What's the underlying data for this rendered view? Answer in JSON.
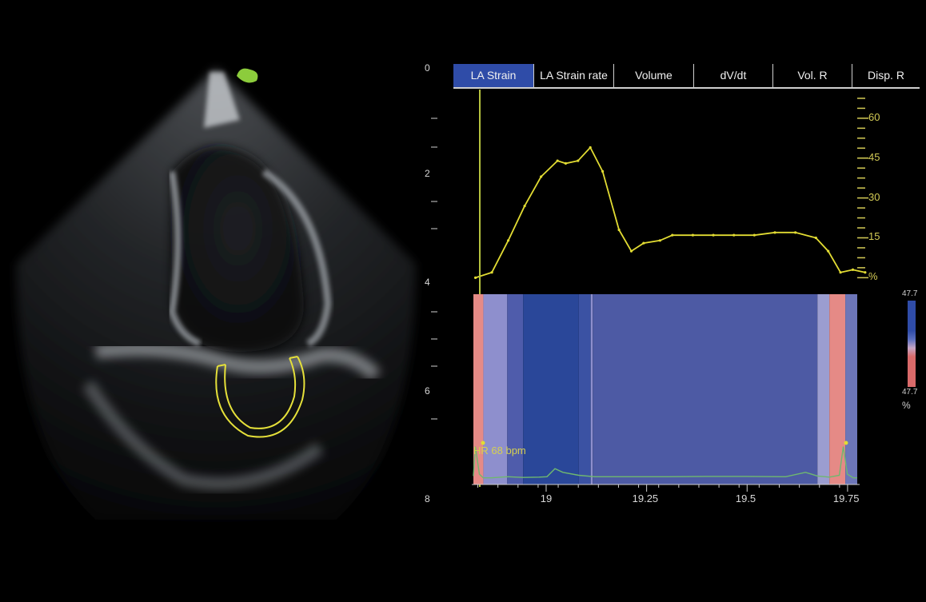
{
  "tabs": [
    {
      "label": "LA Strain",
      "active": true
    },
    {
      "label": "LA Strain rate",
      "active": false
    },
    {
      "label": "Volume",
      "active": false
    },
    {
      "label": "dV/dt",
      "active": false
    },
    {
      "label": "Vol. R",
      "active": false
    },
    {
      "label": "Disp. R",
      "active": false
    }
  ],
  "left_axis_labels": [
    "0",
    "2",
    "4",
    "6",
    "8"
  ],
  "strain_axis": {
    "ticks": [
      "60",
      "45",
      "30",
      "15",
      "%"
    ]
  },
  "colorbar": {
    "top": "47.7",
    "bottom": "47.7",
    "unit": "%",
    "colors": [
      "#2f4ca8",
      "#5b6fc0",
      "#c7a5c4",
      "#d96a6a"
    ]
  },
  "heart_rate_label": "HR 68 bpm",
  "time_axis": {
    "ticks": [
      "19",
      "19.25",
      "19.5",
      "19.75"
    ]
  },
  "colors": {
    "strain_curve": "#e2dc33",
    "ecg": "#6fb86f",
    "cursor": "#b5c23e",
    "tracking_roi": "#e5e03a",
    "marker": "#8ccc3c"
  },
  "chart_data": {
    "type": "line",
    "x": [
      18.82,
      18.86,
      18.9,
      18.94,
      18.98,
      19.02,
      19.04,
      19.07,
      19.1,
      19.13,
      19.17,
      19.2,
      19.23,
      19.27,
      19.3,
      19.35,
      19.4,
      19.45,
      19.5,
      19.55,
      19.6,
      19.65,
      19.68,
      19.71,
      19.74,
      19.77
    ],
    "y": [
      0,
      2,
      14,
      27,
      38,
      44,
      43,
      44,
      49,
      40,
      18,
      10,
      13,
      14,
      16,
      16,
      16,
      16,
      16,
      17,
      17,
      15,
      10,
      2,
      3,
      2
    ],
    "xlabel": "",
    "ylabel": "",
    "ylim": [
      -2,
      72
    ],
    "xlim": [
      18.815,
      19.78
    ],
    "y_ticks": [
      60,
      45,
      30,
      15
    ]
  },
  "segments": [
    {
      "x0": 18.815,
      "x1": 18.84,
      "color": "#e58a86"
    },
    {
      "x0": 18.84,
      "x1": 18.9,
      "color": "#8e8fcd"
    },
    {
      "x0": 18.9,
      "x1": 18.94,
      "color": "#4f5cab"
    },
    {
      "x0": 18.94,
      "x1": 19.08,
      "color": "#2a4799"
    },
    {
      "x0": 19.08,
      "x1": 19.11,
      "color": "#3b52a3"
    },
    {
      "x0": 19.11,
      "x1": 19.115,
      "color": "#8e8fcd"
    },
    {
      "x0": 19.115,
      "x1": 19.68,
      "color": "#4d5aa4"
    },
    {
      "x0": 19.68,
      "x1": 19.71,
      "color": "#9b9dd0"
    },
    {
      "x0": 19.71,
      "x1": 19.75,
      "color": "#e58a86"
    },
    {
      "x0": 19.75,
      "x1": 19.78,
      "color": "#6d76b8"
    }
  ],
  "ecg_trace": {
    "x": [
      18.815,
      18.82,
      18.83,
      18.84,
      18.86,
      18.9,
      18.94,
      18.98,
      19.0,
      19.02,
      19.04,
      19.08,
      19.12,
      19.2,
      19.3,
      19.4,
      19.5,
      19.6,
      19.65,
      19.68,
      19.71,
      19.735,
      19.745,
      19.755,
      19.77,
      19.78
    ],
    "y": [
      0.1,
      0.9,
      0.15,
      0.05,
      0.05,
      0.08,
      0.06,
      0.07,
      0.08,
      0.3,
      0.2,
      0.12,
      0.08,
      0.08,
      0.08,
      0.09,
      0.09,
      0.08,
      0.2,
      0.1,
      0.07,
      0.12,
      0.9,
      0.15,
      0.05,
      0.05
    ]
  }
}
